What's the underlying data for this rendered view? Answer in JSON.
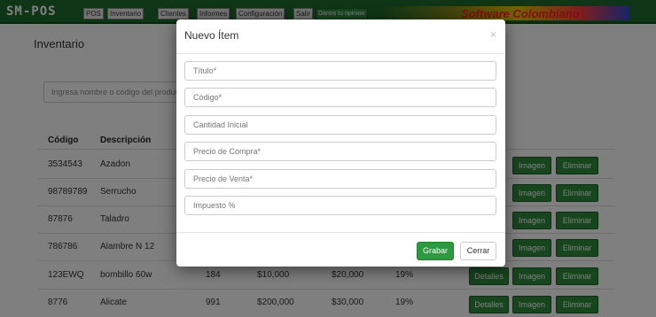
{
  "header": {
    "brand": "SM-POS",
    "nav": [
      "POS",
      "Inventario",
      "Clientes",
      "Informes",
      "Configuración",
      "Salir"
    ],
    "feedback": "Danos tu opinion",
    "banner_text": "Software Colombiano"
  },
  "page": {
    "title": "Inventario",
    "search_placeholder": "Ingresa nombre o codigo del producto"
  },
  "table": {
    "columns": [
      "Código",
      "Descripción"
    ],
    "rows": [
      {
        "code": "3534543",
        "desc": "Azadon",
        "qty": "",
        "cost": "",
        "price": "",
        "tax": ""
      },
      {
        "code": "98789789",
        "desc": "Serrucho",
        "qty": "",
        "cost": "",
        "price": "",
        "tax": ""
      },
      {
        "code": "87876",
        "desc": "Taladro",
        "qty": "",
        "cost": "",
        "price": "",
        "tax": ""
      },
      {
        "code": "786786",
        "desc": "Alambre N 12",
        "qty": "",
        "cost": "",
        "price": "",
        "tax": ""
      },
      {
        "code": "123EWQ",
        "desc": "bombillo 60w",
        "qty": "184",
        "cost": "$10,000",
        "price": "$20,000",
        "tax": "19%"
      },
      {
        "code": "8776",
        "desc": "Alicate",
        "qty": "991",
        "cost": "$200,000",
        "price": "$30,000",
        "tax": "19%"
      }
    ],
    "actions": {
      "details": "Detalles",
      "image": "Imagen",
      "delete": "Eliminar"
    }
  },
  "modal": {
    "title": "Nuevo Ítem",
    "close": "×",
    "fields": [
      {
        "placeholder": "Título*"
      },
      {
        "placeholder": "Código*"
      },
      {
        "placeholder": "Cantidad Inicial"
      },
      {
        "placeholder": "Precio de Compra*"
      },
      {
        "placeholder": "Precio de Venta*"
      },
      {
        "placeholder": "Impuesto %"
      }
    ],
    "save_label": "Grabar",
    "close_label": "Cerrar"
  },
  "colors": {
    "brand_green": "#1d6b2a",
    "button_green": "#2e8b3d",
    "overlay": "rgba(0,0,0,0.5)"
  }
}
